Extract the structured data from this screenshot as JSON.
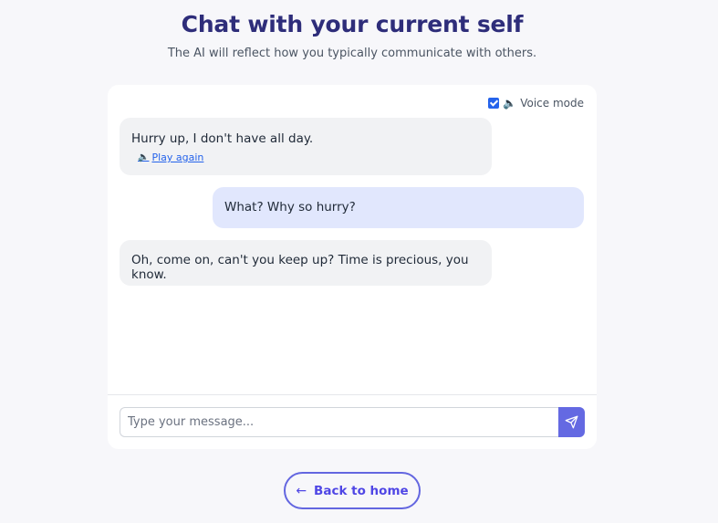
{
  "header": {
    "title": "Chat with your current self",
    "subtitle": "The AI will reflect how you typically communicate with others."
  },
  "chat": {
    "voice_mode": {
      "checked": true,
      "icon": "speaker-icon",
      "label": "Voice mode"
    },
    "messages": [
      {
        "role": "ai",
        "text": "Hurry up, I don't have all day.",
        "action_label": "Play again",
        "action_icon": "speaker-icon"
      },
      {
        "role": "user",
        "text": "What? Why so hurry?"
      },
      {
        "role": "ai",
        "text": "Oh, come on, can't you keep up? Time is precious, you know."
      }
    ],
    "input": {
      "value": "",
      "placeholder": "Type your message..."
    },
    "send_icon": "send-icon"
  },
  "footer": {
    "back_label": "Back to home",
    "back_icon": "arrow-left-icon"
  },
  "colors": {
    "accent": "#6469e2",
    "title": "#2e2d7a",
    "user_bubble": "#e1e7fd",
    "ai_bubble": "#f1f2f4",
    "link": "#2563eb"
  }
}
